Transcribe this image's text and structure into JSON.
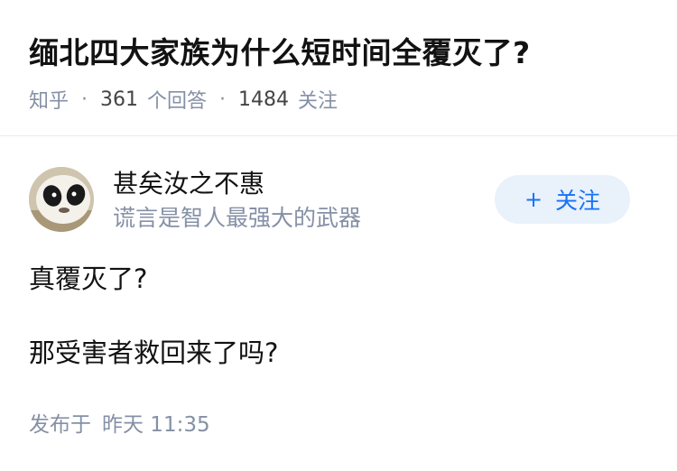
{
  "question": {
    "title": "缅北四大家族为什么短时间全覆灭了?",
    "source": "知乎",
    "answer_count": "361",
    "answer_label": "个回答",
    "follower_count": "1484",
    "follower_label": "关注",
    "separator": "·"
  },
  "author": {
    "name": "甚矣汝之不惠",
    "bio": "谎言是智人最强大的武器",
    "avatar_icon": "panda-avatar-icon"
  },
  "follow_button": {
    "icon": "+",
    "label": "关注"
  },
  "answer": {
    "paragraphs": [
      "真覆灭了?",
      "那受害者救回来了吗?"
    ]
  },
  "publish": {
    "label": "发布于",
    "time": "昨天 11:35"
  },
  "colors": {
    "accent": "#1772f6",
    "follow_bg": "#e9f1fb",
    "meta_text": "#8590a6",
    "title_text": "#121212"
  }
}
